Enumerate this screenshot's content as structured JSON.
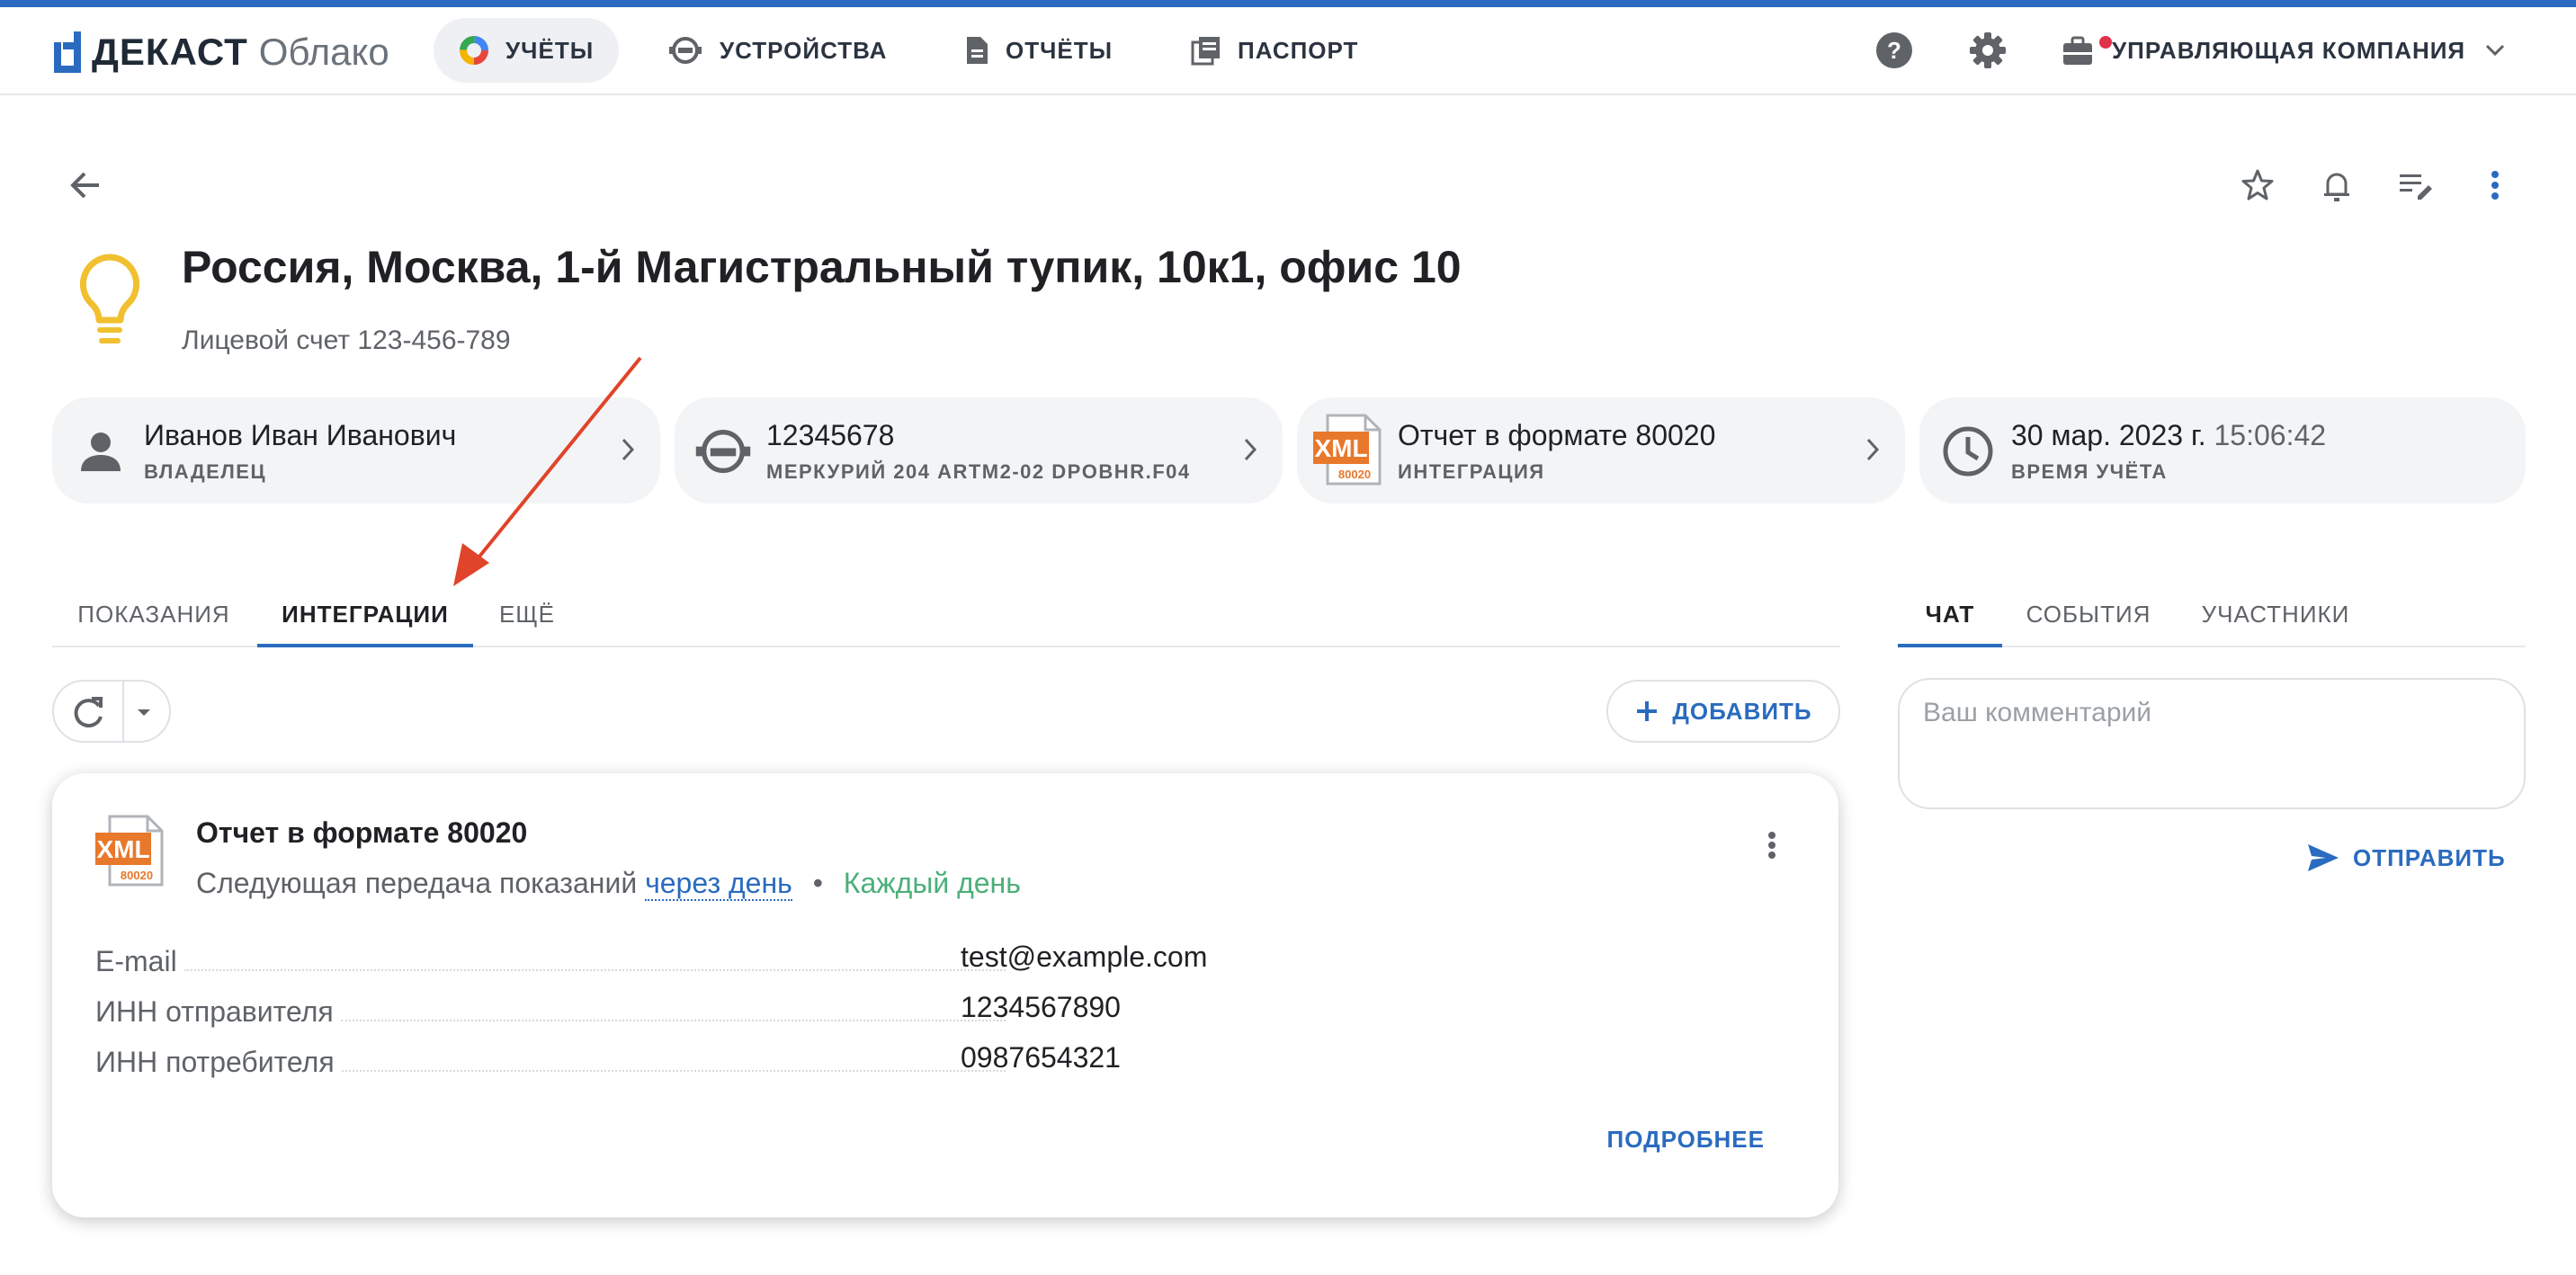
{
  "brand": {
    "name": "ДЕКАСТ",
    "sub": "Облако",
    "color": "#2a6bbf"
  },
  "nav": {
    "items": [
      {
        "label": "УЧЁТЫ",
        "icon": "pie-chart-icon",
        "active": true
      },
      {
        "label": "УСТРОЙСТВА",
        "icon": "meter-icon"
      },
      {
        "label": "ОТЧЁТЫ",
        "icon": "document-icon"
      },
      {
        "label": "ПАСПОРТ",
        "icon": "passport-icon"
      }
    ],
    "help_icon": "help-icon",
    "settings_icon": "gear-icon",
    "company_label": "УПРАВЛЯЮЩАЯ КОМПАНИЯ"
  },
  "header": {
    "title": "Россия, Москва, 1-й Магистральный тупик, 10к1, офис 10",
    "subtitle": "Лицевой счет 123-456-789",
    "icon": "lightbulb-icon"
  },
  "info_cards": [
    {
      "title": "Иванов Иван Иванович",
      "caption": "ВЛАДЕЛЕЦ",
      "icon": "person-icon"
    },
    {
      "title": "12345678",
      "caption": "МЕРКУРИЙ 204 ARTM2-02 DPOBHR.F04",
      "icon": "meter-icon"
    },
    {
      "title": "Отчет в формате 80020",
      "caption": "ИНТЕГРАЦИЯ",
      "icon": "xml-file-icon",
      "badge": "XML",
      "badge_sub": "80020"
    },
    {
      "title": "30 мар. 2023 г.",
      "time": "15:06:42",
      "caption": "ВРЕМЯ УЧЁТА",
      "icon": "clock-icon"
    }
  ],
  "tabs": [
    {
      "label": "ПОКАЗАНИЯ"
    },
    {
      "label": "ИНТЕГРАЦИИ",
      "active": true
    },
    {
      "label": "ЕЩЁ"
    }
  ],
  "right_tabs": [
    {
      "label": "ЧАТ",
      "active": true
    },
    {
      "label": "СОБЫТИЯ"
    },
    {
      "label": "УЧАСТНИКИ"
    }
  ],
  "toolbar": {
    "add_label": "ДОБАВИТЬ"
  },
  "integration": {
    "badge": "XML",
    "badge_sub": "80020",
    "title": "Отчет в формате 80020",
    "line_prefix": "Следующая передача показаний",
    "next": "через день",
    "frequency": "Каждый день",
    "fields": [
      {
        "label": "E-mail",
        "value": "test@example.com"
      },
      {
        "label": "ИНН отправителя",
        "value": "1234567890"
      },
      {
        "label": "ИНН потребителя",
        "value": "0987654321"
      }
    ],
    "more_label": "ПОДРОБНЕЕ"
  },
  "chat": {
    "placeholder": "Ваш комментарий",
    "send_label": "ОТПРАВИТЬ"
  },
  "colors": {
    "accent": "#2a6bbf",
    "success": "#4caf7a",
    "annotation": "#e0442a",
    "bulb": "#f0c030"
  }
}
